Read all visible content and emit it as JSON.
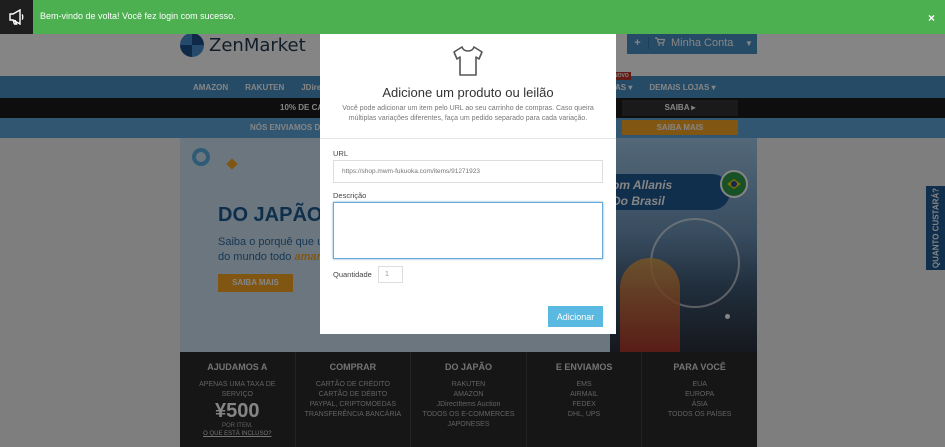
{
  "toast": {
    "message": "Bem-vindo de volta! Você fez login com sucesso.",
    "close": "×",
    "color": "#4caf50"
  },
  "header": {
    "logo": "ZenMarket",
    "account_label": "Minha Conta",
    "plus": "+",
    "cart_icon": "cart-icon"
  },
  "nav": {
    "items": [
      "AMAZON",
      "RAKUTEN",
      "JDirectI"
    ],
    "right_items": [
      "AS ▾",
      "DEMAIS LOJAS ▾"
    ],
    "badge": "NOVO"
  },
  "promo": {
    "text": "10% DE CA",
    "button": "SAIBA ▸"
  },
  "ship": {
    "text": "NÓS ENVIAMOS DO",
    "button": "SAIBA MAIS"
  },
  "hero": {
    "title": "DO JAPÃO",
    "line1": "Saiba o porquê que us",
    "line2_prefix": "do mundo todo ",
    "line2_em": "amam",
    "button": "SAIBA MAIS",
    "banner_line1": "om Allanis",
    "banner_line2": "Do Brasil"
  },
  "footer": {
    "cols": [
      {
        "title": "AJUDAMOS A",
        "lines": [
          "APENAS UMA TAXA DE",
          "SERVIÇO"
        ],
        "price": "¥500",
        "per": "POR ITEM.",
        "included": "O QUE ESTÁ INCLUSO?"
      },
      {
        "title": "COMPRAR",
        "lines": [
          "CARTÃO DE CRÉDITO",
          "CARTÃO DE DÉBITO",
          "PAYPAL, CRIPTOMOEDAS",
          "TRANSFERÊNCIA BANCÁRIA"
        ]
      },
      {
        "title": "DO JAPÃO",
        "lines": [
          "RAKUTEN",
          "AMAZON",
          "JDirectItems Auction",
          "TODOS OS E-COMMERCES JAPONESES"
        ]
      },
      {
        "title": "E ENVIAMOS",
        "lines": [
          "EMS",
          "AIRMAIL",
          "FEDEX",
          "DHL, UPS"
        ]
      },
      {
        "title": "PARA VOCÊ",
        "lines": [
          "EUA",
          "EUROPA",
          "ÁSIA",
          "TODOS OS PAÍSES"
        ]
      }
    ]
  },
  "side_tab": "QUANTO CUSTARÁ?",
  "modal": {
    "icon": "tshirt-icon",
    "title": "Adicione um produto ou leilão",
    "description": "Você pode adicionar um item pelo URL ao seu carrinho de compras. Caso queira múltiplas variações diferentes, faça um pedido separado para cada variação.",
    "url_label": "URL",
    "url_placeholder": "https://shop.mwm-fukuoka.com/items/91271923",
    "desc_label": "Descrição",
    "desc_value": "",
    "qty_label": "Quantidade",
    "qty_value": "1",
    "submit": "Adicionar",
    "accent": "#5ab9e1"
  }
}
